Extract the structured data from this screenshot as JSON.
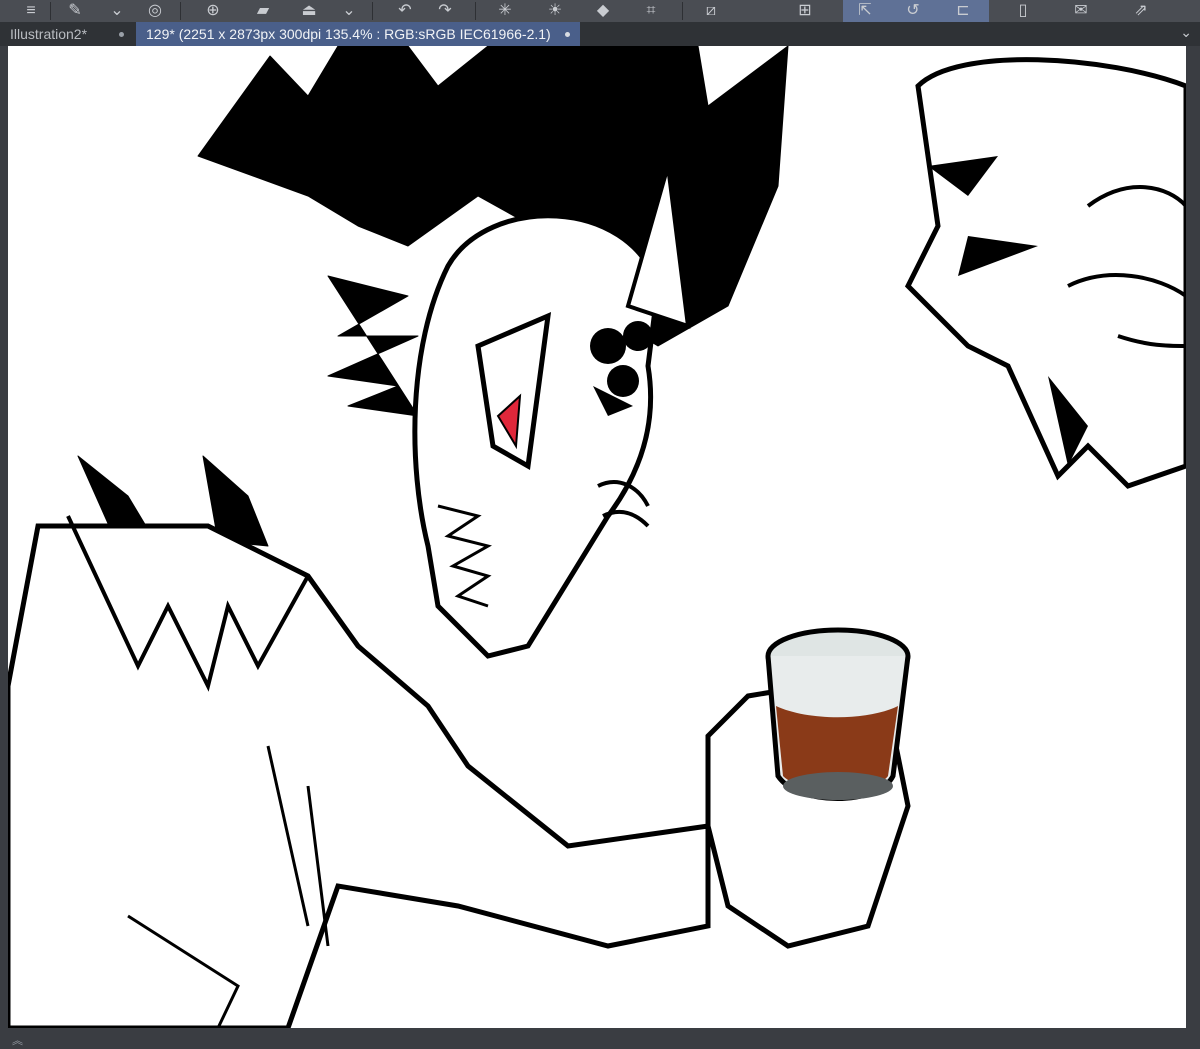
{
  "toolbar": {
    "icons": [
      "menu-icon",
      "pen-icon",
      "chevron-down-icon",
      "layer-icon",
      "new-layer-icon",
      "fill-icon",
      "stamp-icon",
      "chevron-down-icon",
      "undo-icon",
      "redo-icon",
      "loading-icon",
      "brightness-icon",
      "tag-icon",
      "crop-icon",
      "transparent-icon",
      "select-icon",
      "lasso-icon",
      "ruler-icon",
      "device-icon",
      "chat-icon",
      "share-icon"
    ]
  },
  "tabs": [
    {
      "label": "Illustration2*"
    },
    {
      "label": "129* (2251 x 2873px 300dpi 135.4% : RGB:sRGB IEC61966-2.1)"
    }
  ],
  "colors": {
    "accent": "#4a5f8a",
    "eye_red": "#e0273a",
    "liquid": "#8a3a18"
  }
}
